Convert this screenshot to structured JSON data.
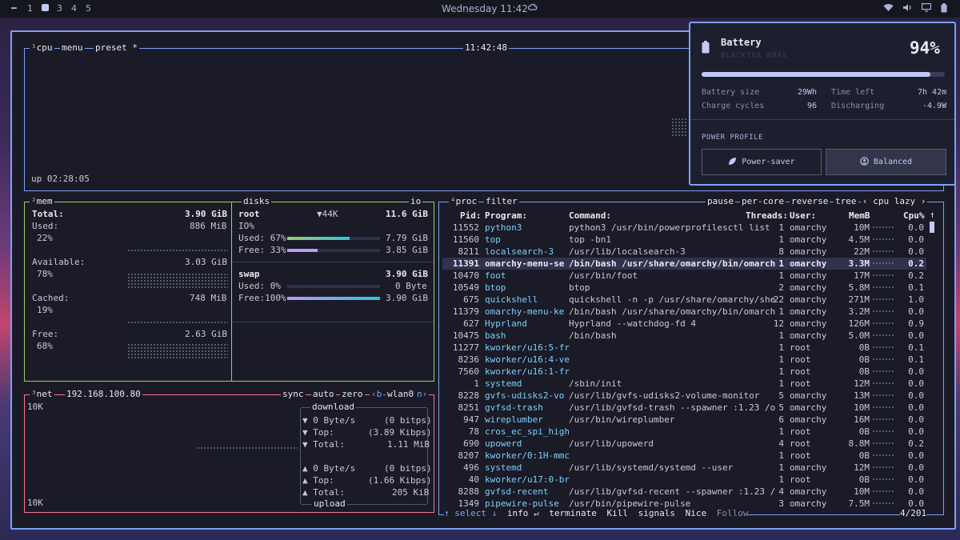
{
  "topbar": {
    "workspaces": [
      "1",
      "3",
      "4",
      "5"
    ],
    "clock": "Wednesday 11:42"
  },
  "cpu": {
    "index": "¹",
    "label": "cpu",
    "menu": "menu",
    "preset": "preset *",
    "time": "11:42:48",
    "uptime": "up 02:28:05"
  },
  "mem": {
    "index": "²",
    "label": "mem",
    "total_label": "Total:",
    "total": "3.90 GiB",
    "used_label": "Used:",
    "used": "886 MiB",
    "used_pct": "22%",
    "available_label": "Available:",
    "available": "3.03 GiB",
    "available_pct": "78%",
    "cached_label": "Cached:",
    "cached": "748 MiB",
    "cached_pct": "19%",
    "free_label": "Free:",
    "free": "2.63 GiB",
    "free_pct": "68%"
  },
  "disks": {
    "label": "disks",
    "io": "io",
    "root_label": "root",
    "root_io": "▼44K",
    "root_size": "11.6 GiB",
    "io_pct": "IO%",
    "used_label": "Used: 67%",
    "used_value": "7.79 GiB",
    "used_fill": 0.67,
    "free_label": "Free: 33%",
    "free_value": "3.85 GiB",
    "free_fill": 0.33,
    "swap_label": "swap",
    "swap_size": "3.90 GiB",
    "swap_used_label": "Used:  0%",
    "swap_used_value": "0 Byte",
    "swap_used_fill": 0.0,
    "swap_free_label": "Free:100%",
    "swap_free_value": "3.90 GiB",
    "swap_free_fill": 1.0
  },
  "net": {
    "index": "³",
    "label": "net",
    "ip": "192.168.100.80",
    "sync": "sync",
    "auto": "auto",
    "zero": "zero",
    "b": "‹b",
    "iface": "wlan0",
    "n": "n›",
    "scale_top": "10K",
    "scale_bottom": "10K",
    "download_label": "download",
    "dl_rate": "▼ 0 Byte/s",
    "dl_bits": "(0 bitps)",
    "dl_top": "▼ Top:",
    "dl_top_val": "(3.89 Kibps)",
    "dl_total": "▼ Total:",
    "dl_total_val": "1.11 MiB",
    "ul_rate": "▲ 0 Byte/s",
    "ul_bits": "(0 bitps)",
    "ul_top": "▲ Top:",
    "ul_top_val": "(1.66 Kibps)",
    "ul_total": "▲ Total:",
    "ul_total_val": "205 KiB",
    "upload_label": "upload"
  },
  "proc": {
    "index": "⁴",
    "label": "proc",
    "filter": "filter",
    "pause": "pause",
    "per_core": "per-core",
    "reverse": "reverse",
    "tree": "tree",
    "sort": "‹ cpu lazy ›",
    "headers": {
      "pid": "Pid:",
      "program": "Program:",
      "command": "Command:",
      "threads": "Threads:",
      "user": "User:",
      "memb": "MemB",
      "cpu": "Cpu%"
    },
    "rows": [
      {
        "pid": "11552",
        "program": "python3",
        "command": "python3 /usr/bin/powerprofilesctl list",
        "threads": "1",
        "user": "omarchy",
        "mem": "10M",
        "cpu": "0.0"
      },
      {
        "pid": "11560",
        "program": "top",
        "command": "top -bn1",
        "threads": "1",
        "user": "omarchy",
        "mem": "4.5M",
        "cpu": "0.0"
      },
      {
        "pid": "8211",
        "program": "localsearch-3",
        "command": "/usr/lib/localsearch-3",
        "threads": "8",
        "user": "omarchy",
        "mem": "22M",
        "cpu": "0.0"
      },
      {
        "pid": "11391",
        "program": "omarchy-menu-se",
        "command": "/bin/bash /usr/share/omarchy/bin/omarch",
        "threads": "1",
        "user": "omarchy",
        "mem": "3.3M",
        "cpu": "0.2"
      },
      {
        "pid": "10470",
        "program": "foot",
        "command": "/usr/bin/foot",
        "threads": "1",
        "user": "omarchy",
        "mem": "17M",
        "cpu": "0.2"
      },
      {
        "pid": "10549",
        "program": "btop",
        "command": "btop",
        "threads": "2",
        "user": "omarchy",
        "mem": "5.8M",
        "cpu": "0.1"
      },
      {
        "pid": "675",
        "program": "quickshell",
        "command": "quickshell -n -p /usr/share/omarchy/she",
        "threads": "22",
        "user": "omarchy",
        "mem": "271M",
        "cpu": "1.0"
      },
      {
        "pid": "11379",
        "program": "omarchy-menu-ke",
        "command": "/bin/bash /usr/share/omarchy/bin/omarch",
        "threads": "1",
        "user": "omarchy",
        "mem": "3.2M",
        "cpu": "0.0"
      },
      {
        "pid": "627",
        "program": "Hyprland",
        "command": "Hyprland --watchdog-fd 4",
        "threads": "12",
        "user": "omarchy",
        "mem": "126M",
        "cpu": "0.9"
      },
      {
        "pid": "10475",
        "program": "bash",
        "command": "/bin/bash",
        "threads": "1",
        "user": "omarchy",
        "mem": "5.0M",
        "cpu": "0.0"
      },
      {
        "pid": "11277",
        "program": "kworker/u16:5-fr",
        "command": "",
        "threads": "1",
        "user": "root",
        "mem": "0B",
        "cpu": "0.1"
      },
      {
        "pid": "8236",
        "program": "kworker/u16:4-ve",
        "command": "",
        "threads": "1",
        "user": "root",
        "mem": "0B",
        "cpu": "0.1"
      },
      {
        "pid": "7560",
        "program": "kworker/u16:1-fr",
        "command": "",
        "threads": "1",
        "user": "root",
        "mem": "0B",
        "cpu": "0.0"
      },
      {
        "pid": "1",
        "program": "systemd",
        "command": "/sbin/init",
        "threads": "1",
        "user": "root",
        "mem": "12M",
        "cpu": "0.0"
      },
      {
        "pid": "8228",
        "program": "gvfs-udisks2-vo",
        "command": "/usr/lib/gvfs-udisks2-volume-monitor",
        "threads": "5",
        "user": "omarchy",
        "mem": "13M",
        "cpu": "0.0"
      },
      {
        "pid": "8251",
        "program": "gvfsd-trash",
        "command": "/usr/lib/gvfsd-trash --spawner :1.23 /o",
        "threads": "5",
        "user": "omarchy",
        "mem": "10M",
        "cpu": "0.0"
      },
      {
        "pid": "947",
        "program": "wireplumber",
        "command": "/usr/bin/wireplumber",
        "threads": "6",
        "user": "omarchy",
        "mem": "16M",
        "cpu": "0.0"
      },
      {
        "pid": "78",
        "program": "cros_ec_spi_high",
        "command": "",
        "threads": "1",
        "user": "root",
        "mem": "0B",
        "cpu": "0.0"
      },
      {
        "pid": "690",
        "program": "upowerd",
        "command": "/usr/lib/upowerd",
        "threads": "4",
        "user": "root",
        "mem": "8.8M",
        "cpu": "0.2"
      },
      {
        "pid": "8207",
        "program": "kworker/0:1H-mmc",
        "command": "",
        "threads": "1",
        "user": "root",
        "mem": "0B",
        "cpu": "0.0"
      },
      {
        "pid": "496",
        "program": "systemd",
        "command": "/usr/lib/systemd/systemd --user",
        "threads": "1",
        "user": "omarchy",
        "mem": "12M",
        "cpu": "0.0"
      },
      {
        "pid": "40",
        "program": "kworker/u17:0-br",
        "command": "",
        "threads": "1",
        "user": "root",
        "mem": "0B",
        "cpu": "0.0"
      },
      {
        "pid": "8288",
        "program": "gvfsd-recent",
        "command": "/usr/lib/gvfsd-recent --spawner :1.23 /",
        "threads": "4",
        "user": "omarchy",
        "mem": "10M",
        "cpu": "0.0"
      },
      {
        "pid": "1349",
        "program": "pipewire-pulse",
        "command": "/usr/bin/pipewire-pulse",
        "threads": "3",
        "user": "omarchy",
        "mem": "7.5M",
        "cpu": "0.0"
      }
    ],
    "selected_index": 3,
    "footer": {
      "select": "↑ select ↓",
      "info": "info ↵",
      "terminate": "terminate",
      "kill": "Kill",
      "signals": "signals",
      "nice": "Nice",
      "follow": "Follow",
      "count": "4/201"
    }
  },
  "battery": {
    "title": "Battery",
    "subtitle": "BLACKTRA KMAS",
    "percent": "94%",
    "level": 0.94,
    "size_label": "Battery size",
    "size": "29Wh",
    "time_label": "Time left",
    "time": "7h 42m",
    "cycles_label": "Charge cycles",
    "cycles": "96",
    "state_label": "Discharging",
    "state": "-4.9W",
    "profile_label": "POWER PROFILE",
    "profiles": [
      "Power-saver",
      "Balanced"
    ]
  },
  "colors": {
    "accent": "#7aa2f7",
    "mem": "#9ece6a",
    "net": "#f7768e",
    "program": "#7dcfff",
    "bar_green": "#9ece6a",
    "bar_purple": "#bb9af7",
    "bar_teal": "#2ac3de"
  }
}
